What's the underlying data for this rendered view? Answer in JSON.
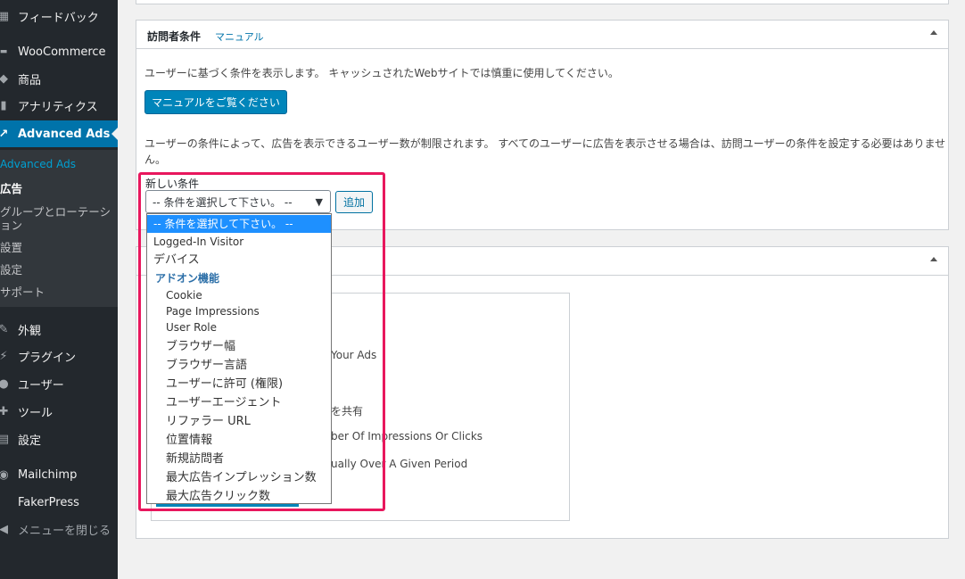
{
  "sidebar": {
    "feedback": "フィードバック",
    "woocommerce": "WooCommerce",
    "products": "商品",
    "analytics": "アナリティクス",
    "advanced_ads": "Advanced Ads",
    "submenu": {
      "head": "Advanced Ads",
      "ads": "広告",
      "groups_line1": "グループとローテーシ",
      "groups_line2": "ョン",
      "placements": "設置",
      "settings": "設定",
      "support": "サポート"
    },
    "appearance": "外観",
    "plugins": "プラグイン",
    "users": "ユーザー",
    "tools": "ツール",
    "settings": "設定",
    "mailchimp": "Mailchimp",
    "fakerpress": "FakerPress",
    "collapse": "メニューを閉じる"
  },
  "visitor_box": {
    "title": "訪問者条件",
    "manual_link": "マニュアル",
    "description": "ユーザーに基づく条件を表示します。 キャッシュされたWebサイトでは慎重に使用してください。",
    "manual_button": "マニュアルをご覧ください",
    "info_line1": "ユーザーの条件によって、広告を表示できるユーザー数が制限されます。 すべてのユーザーに広告を表示させる場合は、訪問ユーザーの条件を設定する必要はありませ",
    "info_line2": "ん。",
    "new_condition_label": "新しい条件",
    "select_value": "-- 条件を選択して下さい。 --",
    "add_button": "追加"
  },
  "dropdown": {
    "selected": "-- 条件を選択して下さい。 --",
    "logged_in": "Logged-In Visitor",
    "device": "デバイス",
    "addon_group": "アドオン機能",
    "addon_items": [
      "Cookie",
      "Page Impressions",
      "User Role",
      "ブラウザー幅",
      "ブラウザー言語",
      "ユーザーに許可 (権限)",
      "ユーザーエージェント",
      "リファラー URL",
      "位置情報",
      "新規訪問者",
      "最大広告インプレッション数",
      "最大広告クリック数"
    ]
  },
  "background_fragments": {
    "your_ads": "Your Ads",
    "share": "を共有",
    "impressions": "ber Of Impressions Or Clicks",
    "period": "ually Over A Given Period"
  },
  "colors": {
    "accent": "#0073aa",
    "highlight": "#e8175d"
  }
}
